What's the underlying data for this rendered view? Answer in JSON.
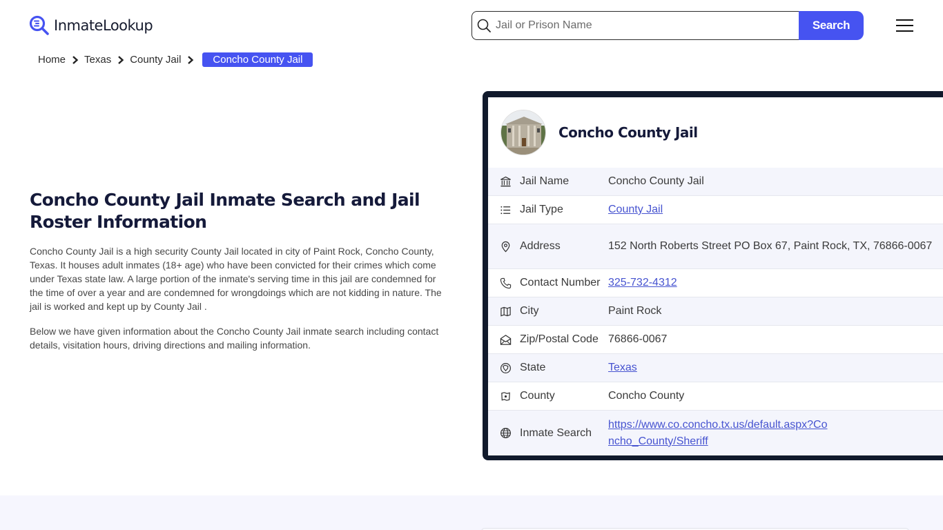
{
  "header": {
    "logo_text": "InmateLookup",
    "search": {
      "placeholder": "Jail or Prison Name",
      "value": "",
      "button_label": "Search"
    },
    "menu_icon": "hamburger-menu-icon"
  },
  "breadcrumb": {
    "items": [
      "Home",
      "Texas",
      "County Jail"
    ],
    "active": "Concho County Jail"
  },
  "main": {
    "title": "Concho County Jail Inmate Search and Jail Roster Information",
    "paragraphs": [
      "Concho County Jail is a high security County Jail located in city of Paint Rock, Concho County, Texas. It houses adult inmates (18+ age) who have been convicted for their crimes which come under Texas state law. A large portion of the inmate's serving time in this jail are condemned for the time of over a year and are condemned for wrongdoings which are not kidding in nature. The jail is worked and kept up by County Jail .",
      "Below we have given information about the Concho County Jail inmate search including contact details, visitation hours, driving directions and mailing information."
    ]
  },
  "card": {
    "title": "Concho County Jail",
    "rows": [
      {
        "icon": "building-columns-icon",
        "label": "Jail Name",
        "value": "Concho County Jail",
        "link": false
      },
      {
        "icon": "list-icon",
        "label": "Jail Type",
        "value": "County Jail",
        "link": true
      },
      {
        "icon": "map-pin-icon",
        "label": "Address",
        "value": "152 North Roberts Street PO Box 67, Paint Rock, TX, 76866-0067",
        "link": false
      },
      {
        "icon": "phone-icon",
        "label": "Contact Number",
        "value": "325-732-4312",
        "link": true
      },
      {
        "icon": "map-icon",
        "label": "City",
        "value": "Paint Rock",
        "link": false
      },
      {
        "icon": "mail-open-icon",
        "label": "Zip/Postal Code",
        "value": "76866-0067",
        "link": false
      },
      {
        "icon": "state-globe-icon",
        "label": "State",
        "value": "Texas",
        "link": true
      },
      {
        "icon": "county-map-icon",
        "label": "County",
        "value": "Concho County",
        "link": false
      },
      {
        "icon": "globe-icon",
        "label": "Inmate Search",
        "value": "https://www.co.concho.tx.us/default.aspx?Concho_County/Sheriff",
        "link": true
      }
    ]
  },
  "colors": {
    "accent": "#4653f1",
    "card_border": "#111a2c",
    "row_alt": "#f4f5fc",
    "link": "#4653d0"
  }
}
